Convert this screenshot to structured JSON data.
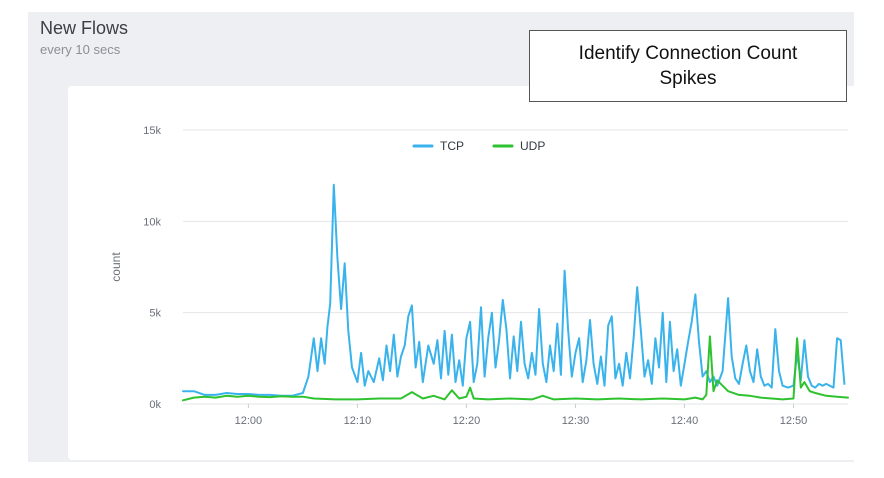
{
  "panel": {
    "title": "New Flows",
    "subtitle": "every 10 secs"
  },
  "callout": {
    "text": "Identify Connection Count\nSpikes"
  },
  "colors": {
    "tcp": "#3ab3ec",
    "udp": "#2fc22f",
    "grid": "#e3e5e9",
    "panel_bg": "#edeff2"
  },
  "chart_data": {
    "type": "line",
    "title": "",
    "xlabel": "",
    "ylabel": "count",
    "ylim": [
      0,
      15000
    ],
    "yticks": [
      {
        "value": 0,
        "label": "0k"
      },
      {
        "value": 5000,
        "label": "5k"
      },
      {
        "value": 10000,
        "label": "10k"
      },
      {
        "value": 15000,
        "label": "15k"
      }
    ],
    "xlim": [
      "11:54",
      "12:55"
    ],
    "xticks": [
      "12:00",
      "12:10",
      "12:20",
      "12:30",
      "12:40",
      "12:50"
    ],
    "grid": true,
    "legend_position": "top-center",
    "series": [
      {
        "name": "TCP",
        "color": "#3ab3ec",
        "points": [
          [
            "11:54:00",
            700
          ],
          [
            "11:55:00",
            700
          ],
          [
            "11:56:00",
            500
          ],
          [
            "11:57:00",
            500
          ],
          [
            "11:58:00",
            600
          ],
          [
            "11:59:00",
            550
          ],
          [
            "12:00:00",
            550
          ],
          [
            "12:01:00",
            500
          ],
          [
            "12:02:00",
            500
          ],
          [
            "12:03:00",
            450
          ],
          [
            "12:04:00",
            450
          ],
          [
            "12:05:00",
            600
          ],
          [
            "12:05:30",
            1500
          ],
          [
            "12:06:00",
            3600
          ],
          [
            "12:06:20",
            1800
          ],
          [
            "12:06:40",
            3600
          ],
          [
            "12:07:00",
            2200
          ],
          [
            "12:07:15",
            4200
          ],
          [
            "12:07:30",
            5500
          ],
          [
            "12:07:50",
            12000
          ],
          [
            "12:08:10",
            8000
          ],
          [
            "12:08:30",
            5200
          ],
          [
            "12:08:50",
            7700
          ],
          [
            "12:09:10",
            4000
          ],
          [
            "12:09:30",
            2000
          ],
          [
            "12:10:00",
            1200
          ],
          [
            "12:10:20",
            2800
          ],
          [
            "12:10:40",
            1000
          ],
          [
            "12:11:00",
            1800
          ],
          [
            "12:11:30",
            1200
          ],
          [
            "12:12:00",
            2500
          ],
          [
            "12:12:20",
            1300
          ],
          [
            "12:12:40",
            3200
          ],
          [
            "12:13:00",
            1800
          ],
          [
            "12:13:20",
            3800
          ],
          [
            "12:13:40",
            1500
          ],
          [
            "12:14:00",
            2600
          ],
          [
            "12:14:20",
            3200
          ],
          [
            "12:14:40",
            4800
          ],
          [
            "12:15:00",
            5400
          ],
          [
            "12:15:20",
            2000
          ],
          [
            "12:15:40",
            3400
          ],
          [
            "12:16:00",
            1200
          ],
          [
            "12:16:30",
            3200
          ],
          [
            "12:17:00",
            2200
          ],
          [
            "12:17:20",
            3500
          ],
          [
            "12:17:40",
            1400
          ],
          [
            "12:18:00",
            4000
          ],
          [
            "12:18:20",
            1600
          ],
          [
            "12:18:40",
            3800
          ],
          [
            "12:19:00",
            1200
          ],
          [
            "12:19:20",
            2400
          ],
          [
            "12:19:40",
            1000
          ],
          [
            "12:20:00",
            3600
          ],
          [
            "12:20:20",
            4500
          ],
          [
            "12:20:40",
            1200
          ],
          [
            "12:21:00",
            2200
          ],
          [
            "12:21:20",
            5300
          ],
          [
            "12:21:40",
            1500
          ],
          [
            "12:22:00",
            3600
          ],
          [
            "12:22:20",
            5000
          ],
          [
            "12:22:40",
            2000
          ],
          [
            "12:23:00",
            3500
          ],
          [
            "12:23:20",
            5700
          ],
          [
            "12:23:40",
            4100
          ],
          [
            "12:24:00",
            1400
          ],
          [
            "12:24:20",
            3700
          ],
          [
            "12:24:40",
            1800
          ],
          [
            "12:25:00",
            4500
          ],
          [
            "12:25:20",
            2200
          ],
          [
            "12:25:40",
            1400
          ],
          [
            "12:26:00",
            2800
          ],
          [
            "12:26:20",
            1600
          ],
          [
            "12:26:40",
            5200
          ],
          [
            "12:27:00",
            2200
          ],
          [
            "12:27:20",
            1200
          ],
          [
            "12:27:40",
            3200
          ],
          [
            "12:28:00",
            1800
          ],
          [
            "12:28:20",
            4400
          ],
          [
            "12:28:40",
            1600
          ],
          [
            "12:29:00",
            7300
          ],
          [
            "12:29:20",
            4000
          ],
          [
            "12:29:40",
            1500
          ],
          [
            "12:30:00",
            2800
          ],
          [
            "12:30:20",
            3600
          ],
          [
            "12:30:40",
            1200
          ],
          [
            "12:31:00",
            2400
          ],
          [
            "12:31:20",
            4600
          ],
          [
            "12:31:40",
            2200
          ],
          [
            "12:32:00",
            1100
          ],
          [
            "12:32:20",
            2600
          ],
          [
            "12:32:40",
            1000
          ],
          [
            "12:33:00",
            4300
          ],
          [
            "12:33:20",
            4800
          ],
          [
            "12:33:40",
            1400
          ],
          [
            "12:34:00",
            2200
          ],
          [
            "12:34:20",
            1000
          ],
          [
            "12:34:40",
            2800
          ],
          [
            "12:35:00",
            1400
          ],
          [
            "12:35:20",
            3600
          ],
          [
            "12:35:40",
            6400
          ],
          [
            "12:36:00",
            4000
          ],
          [
            "12:36:20",
            1500
          ],
          [
            "12:36:40",
            2400
          ],
          [
            "12:37:00",
            1100
          ],
          [
            "12:37:20",
            3600
          ],
          [
            "12:37:40",
            2000
          ],
          [
            "12:38:00",
            5000
          ],
          [
            "12:38:20",
            1200
          ],
          [
            "12:38:40",
            4500
          ],
          [
            "12:39:00",
            1800
          ],
          [
            "12:39:20",
            3000
          ],
          [
            "12:39:40",
            1000
          ],
          [
            "12:40:00",
            2200
          ],
          [
            "12:40:20",
            3400
          ],
          [
            "12:40:40",
            4500
          ],
          [
            "12:41:00",
            6000
          ],
          [
            "12:41:20",
            3400
          ],
          [
            "12:41:40",
            1500
          ],
          [
            "12:42:00",
            1800
          ],
          [
            "12:42:20",
            1200
          ],
          [
            "12:42:40",
            1500
          ],
          [
            "12:43:00",
            1000
          ],
          [
            "12:43:30",
            1800
          ],
          [
            "12:44:00",
            5800
          ],
          [
            "12:44:20",
            2600
          ],
          [
            "12:44:40",
            1400
          ],
          [
            "12:45:00",
            1100
          ],
          [
            "12:45:20",
            2200
          ],
          [
            "12:45:40",
            3200
          ],
          [
            "12:46:00",
            1800
          ],
          [
            "12:46:20",
            1200
          ],
          [
            "12:46:40",
            3000
          ],
          [
            "12:47:00",
            1500
          ],
          [
            "12:47:20",
            1000
          ],
          [
            "12:47:40",
            1100
          ],
          [
            "12:48:00",
            900
          ],
          [
            "12:48:20",
            4100
          ],
          [
            "12:48:40",
            1800
          ],
          [
            "12:49:00",
            1000
          ],
          [
            "12:49:30",
            900
          ],
          [
            "12:50:00",
            1000
          ],
          [
            "12:50:20",
            2800
          ],
          [
            "12:50:40",
            1300
          ],
          [
            "12:51:00",
            3500
          ],
          [
            "12:51:20",
            1500
          ],
          [
            "12:51:40",
            1000
          ],
          [
            "12:52:00",
            900
          ],
          [
            "12:52:20",
            1100
          ],
          [
            "12:52:40",
            1000
          ],
          [
            "12:53:00",
            1100
          ],
          [
            "12:53:20",
            1000
          ],
          [
            "12:53:40",
            900
          ],
          [
            "12:54:00",
            3600
          ],
          [
            "12:54:20",
            3500
          ],
          [
            "12:54:40",
            1100
          ]
        ]
      },
      {
        "name": "UDP",
        "color": "#2fc22f",
        "points": [
          [
            "11:54:00",
            200
          ],
          [
            "11:55:00",
            350
          ],
          [
            "11:56:00",
            400
          ],
          [
            "11:57:00",
            350
          ],
          [
            "11:58:00",
            450
          ],
          [
            "11:59:00",
            400
          ],
          [
            "12:00:00",
            450
          ],
          [
            "12:01:00",
            400
          ],
          [
            "12:02:00",
            380
          ],
          [
            "12:03:00",
            420
          ],
          [
            "12:04:00",
            400
          ],
          [
            "12:05:00",
            400
          ],
          [
            "12:06:00",
            300
          ],
          [
            "12:08:00",
            250
          ],
          [
            "12:10:00",
            250
          ],
          [
            "12:12:00",
            300
          ],
          [
            "12:14:00",
            300
          ],
          [
            "12:15:00",
            650
          ],
          [
            "12:16:00",
            300
          ],
          [
            "12:17:00",
            450
          ],
          [
            "12:18:00",
            250
          ],
          [
            "12:18:40",
            750
          ],
          [
            "12:19:20",
            300
          ],
          [
            "12:20:00",
            400
          ],
          [
            "12:20:20",
            900
          ],
          [
            "12:20:40",
            300
          ],
          [
            "12:22:00",
            250
          ],
          [
            "12:24:00",
            300
          ],
          [
            "12:26:00",
            250
          ],
          [
            "12:27:00",
            450
          ],
          [
            "12:28:00",
            250
          ],
          [
            "12:30:00",
            300
          ],
          [
            "12:32:00",
            250
          ],
          [
            "12:34:00",
            300
          ],
          [
            "12:36:00",
            250
          ],
          [
            "12:38:00",
            300
          ],
          [
            "12:40:00",
            250
          ],
          [
            "12:41:00",
            350
          ],
          [
            "12:41:40",
            250
          ],
          [
            "12:42:00",
            500
          ],
          [
            "12:42:20",
            3700
          ],
          [
            "12:42:40",
            700
          ],
          [
            "12:43:00",
            1300
          ],
          [
            "12:43:30",
            1000
          ],
          [
            "12:44:00",
            700
          ],
          [
            "12:45:00",
            500
          ],
          [
            "12:46:00",
            450
          ],
          [
            "12:47:00",
            350
          ],
          [
            "12:48:00",
            300
          ],
          [
            "12:49:00",
            250
          ],
          [
            "12:50:00",
            300
          ],
          [
            "12:50:20",
            3600
          ],
          [
            "12:50:40",
            900
          ],
          [
            "12:51:00",
            1200
          ],
          [
            "12:51:30",
            700
          ],
          [
            "12:52:00",
            600
          ],
          [
            "12:53:00",
            450
          ],
          [
            "12:54:00",
            400
          ],
          [
            "12:55:00",
            350
          ]
        ]
      }
    ]
  }
}
